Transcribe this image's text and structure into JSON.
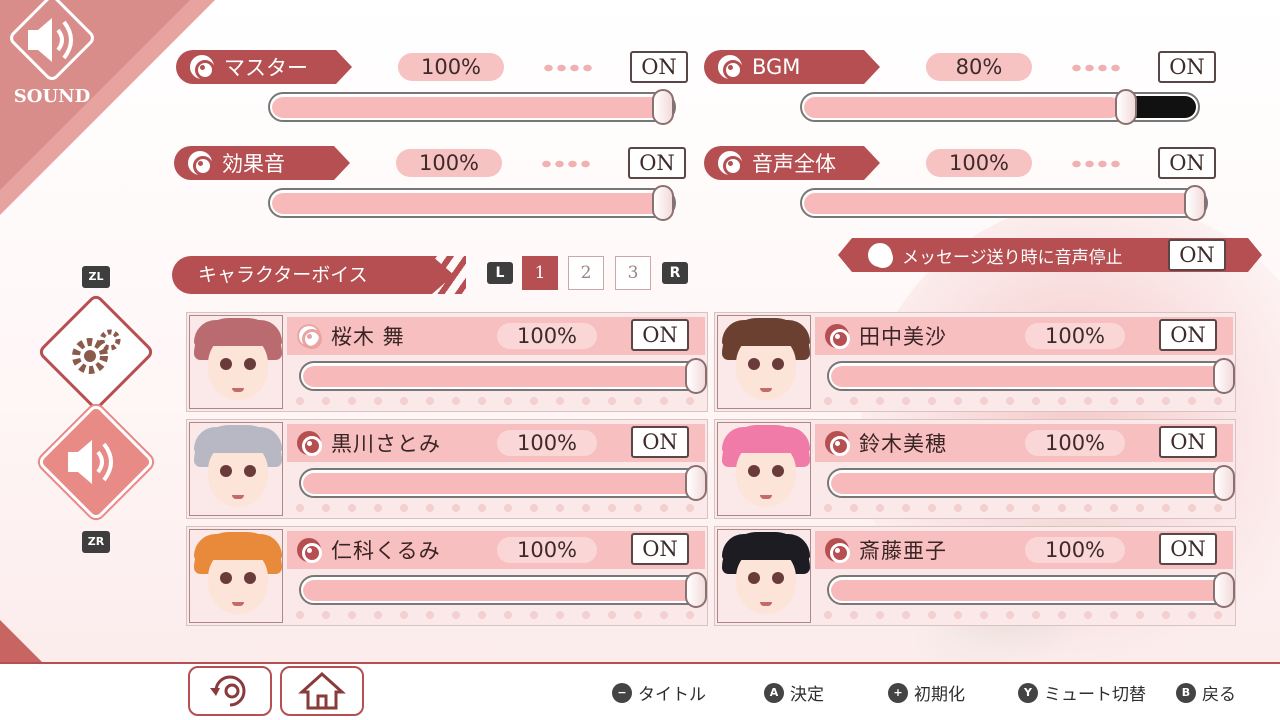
{
  "screen": {
    "title": "SOUND"
  },
  "master": [
    {
      "label": "マスター",
      "percent": "100%",
      "level": 1.0,
      "toggle": "ON"
    },
    {
      "label": "BGM",
      "percent": "80%",
      "level": 0.8,
      "toggle": "ON"
    },
    {
      "label": "効果音",
      "percent": "100%",
      "level": 1.0,
      "toggle": "ON"
    },
    {
      "label": "音声全体",
      "percent": "100%",
      "level": 1.0,
      "toggle": "ON"
    }
  ],
  "message_stop": {
    "label": "メッセージ送り時に音声停止",
    "toggle": "ON"
  },
  "character_voice": {
    "title": "キャラクターボイス",
    "pages": [
      "1",
      "2",
      "3"
    ],
    "current_page": "1",
    "prev_key": "L",
    "next_key": "R",
    "characters": [
      {
        "name": "桜木 舞",
        "percent": "100%",
        "level": 1.0,
        "toggle": "ON",
        "hair_color": "#b96b6f"
      },
      {
        "name": "田中美沙",
        "percent": "100%",
        "level": 1.0,
        "toggle": "ON",
        "hair_color": "#6b4030"
      },
      {
        "name": "黒川さとみ",
        "percent": "100%",
        "level": 1.0,
        "toggle": "ON",
        "hair_color": "#b8b8c4"
      },
      {
        "name": "鈴木美穂",
        "percent": "100%",
        "level": 1.0,
        "toggle": "ON",
        "hair_color": "#f07aa8"
      },
      {
        "name": "仁科くるみ",
        "percent": "100%",
        "level": 1.0,
        "toggle": "ON",
        "hair_color": "#e88a3a"
      },
      {
        "name": "斎藤亜子",
        "percent": "100%",
        "level": 1.0,
        "toggle": "ON",
        "hair_color": "#1c1c22"
      }
    ]
  },
  "side": {
    "zl": "ZL",
    "zr": "ZR",
    "settings_icon": "gear-icon",
    "sound_icon": "speaker-icon"
  },
  "bottom": {
    "buttons": [
      "reset-icon",
      "home-icon"
    ],
    "hints": [
      {
        "key": "−",
        "label": "タイトル"
      },
      {
        "key": "A",
        "label": "決定"
      },
      {
        "key": "+",
        "label": "初期化"
      },
      {
        "key": "Y",
        "label": "ミュート切替"
      },
      {
        "key": "B",
        "label": "戻る"
      }
    ]
  },
  "colors": {
    "accent": "#b54f51",
    "pink": "#f7bfbf"
  }
}
